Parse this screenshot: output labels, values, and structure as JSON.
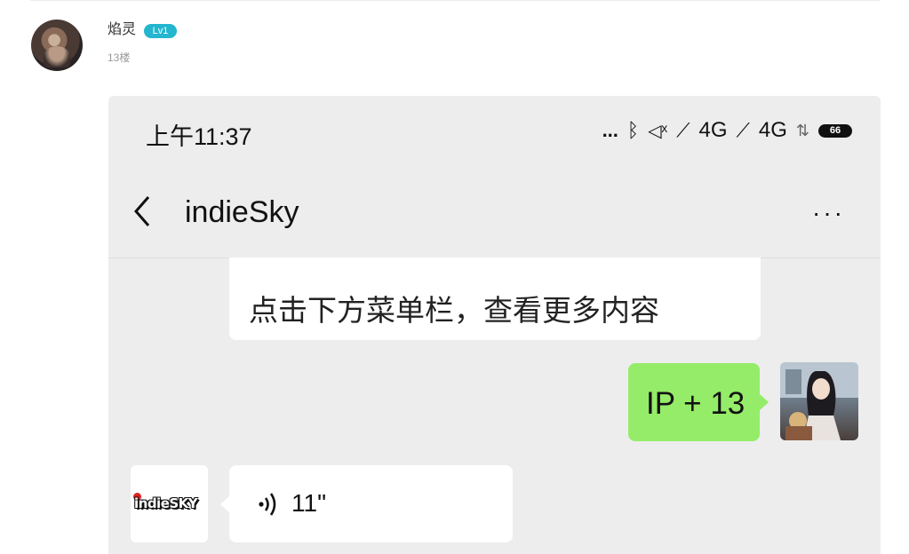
{
  "post": {
    "username": "焰灵",
    "level": "Lv1",
    "floor": "13楼"
  },
  "phone": {
    "status_bar": {
      "time": "上午11:37",
      "dots": "...",
      "bluetooth_icon": "bluetooth-icon",
      "vibrate_icon": "vibrate-icon",
      "signal1": "4G",
      "signal2": "4G",
      "battery": "66"
    },
    "chat": {
      "title": "indieSky",
      "system_message": "点击下方菜单栏，查看更多内容",
      "sent_message": "IP + 13",
      "voice_duration": "11\"",
      "bot_logo": "indieSKY"
    }
  },
  "colors": {
    "sent_bubble": "#95ec69",
    "chat_bg": "#ededed",
    "level_badge": "#24b6cf"
  }
}
